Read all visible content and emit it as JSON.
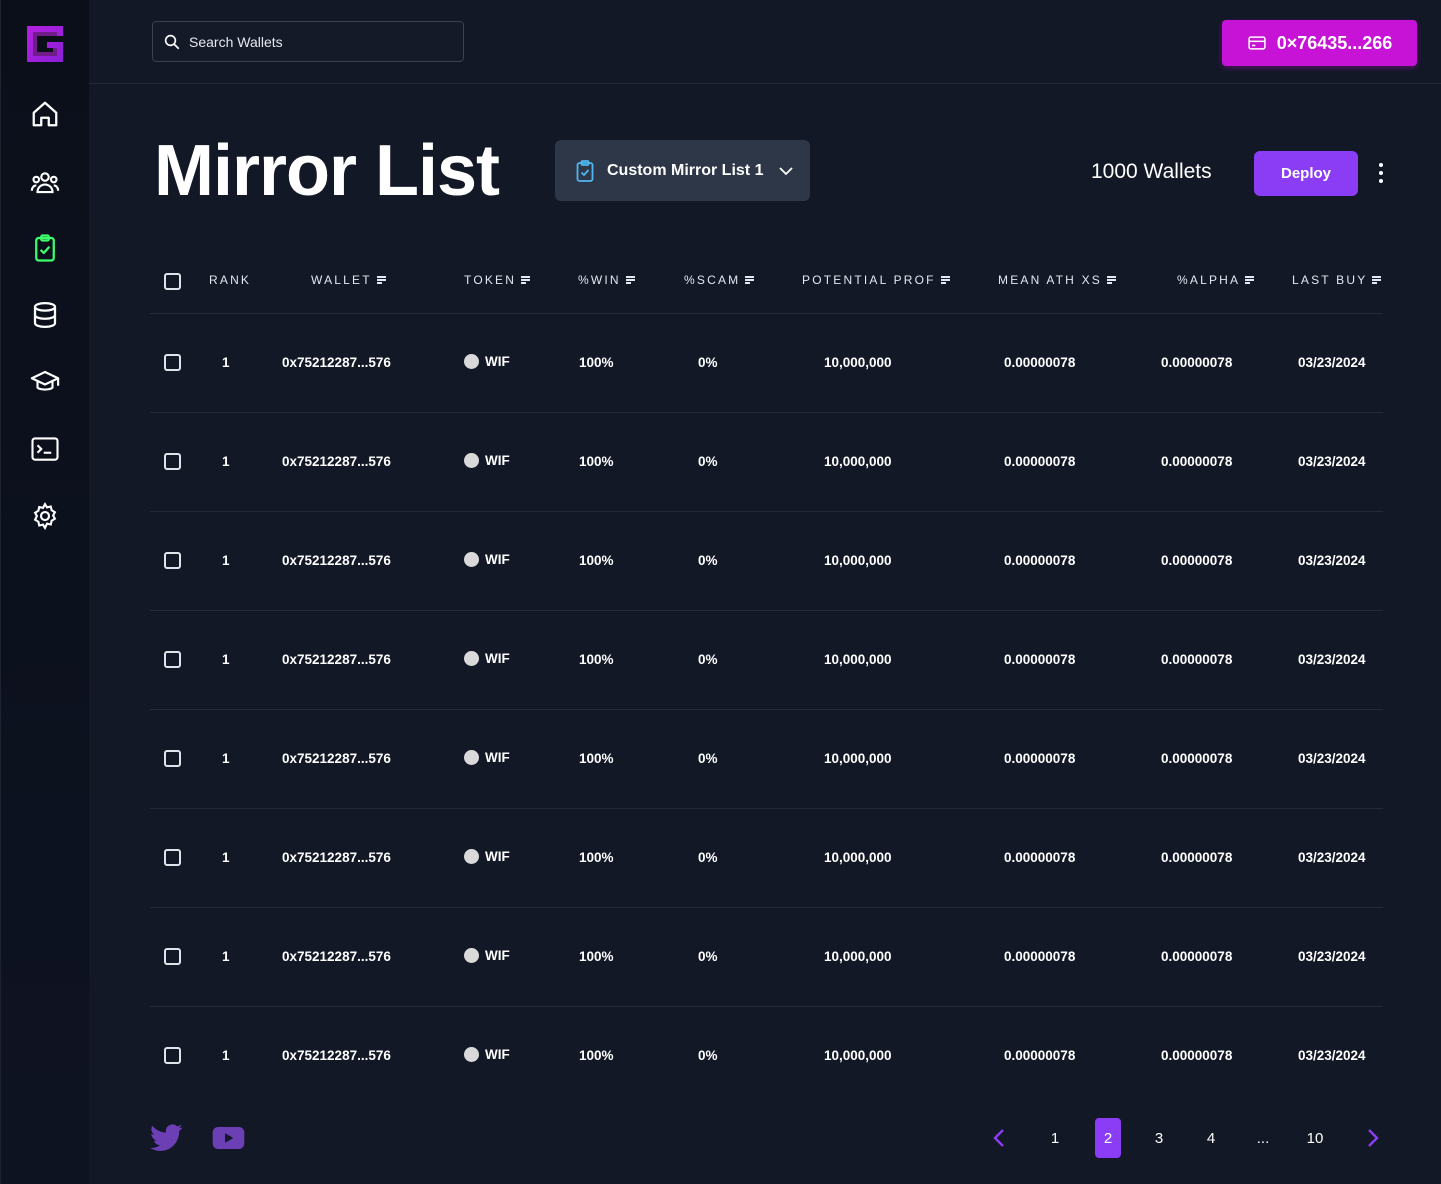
{
  "colors": {
    "accent": "#8b3df5",
    "wallet_button": "#c613d6",
    "active_nav": "#3dff6a",
    "background": "#121826"
  },
  "sidebar": {
    "items": [
      {
        "icon": "home-icon"
      },
      {
        "icon": "users-icon"
      },
      {
        "icon": "clipboard-check-icon",
        "active": true
      },
      {
        "icon": "database-icon"
      },
      {
        "icon": "graduation-cap-icon"
      },
      {
        "icon": "terminal-icon"
      },
      {
        "icon": "gear-icon"
      }
    ]
  },
  "topbar": {
    "search_placeholder": "Search Wallets",
    "wallet_address": "0×76435...266"
  },
  "header": {
    "title": "Mirror List",
    "list_selector": "Custom Mirror List 1",
    "wallet_count": "1000 Wallets",
    "deploy_label": "Deploy"
  },
  "table": {
    "columns": [
      "RANK",
      "WALLET",
      "TOKEN",
      "%WIN",
      "%SCAM",
      "POTENTIAL PROF",
      "MEAN ATH XS",
      "%ALPHA",
      "LAST BUY"
    ],
    "rows": [
      {
        "rank": "1",
        "wallet": "0x75212287...576",
        "token": "WIF",
        "win": "100%",
        "scam": "0%",
        "potential": "10,000,000",
        "mean_ath": "0.00000078",
        "alpha": "0.00000078",
        "last_buy": "03/23/2024"
      },
      {
        "rank": "1",
        "wallet": "0x75212287...576",
        "token": "WIF",
        "win": "100%",
        "scam": "0%",
        "potential": "10,000,000",
        "mean_ath": "0.00000078",
        "alpha": "0.00000078",
        "last_buy": "03/23/2024"
      },
      {
        "rank": "1",
        "wallet": "0x75212287...576",
        "token": "WIF",
        "win": "100%",
        "scam": "0%",
        "potential": "10,000,000",
        "mean_ath": "0.00000078",
        "alpha": "0.00000078",
        "last_buy": "03/23/2024"
      },
      {
        "rank": "1",
        "wallet": "0x75212287...576",
        "token": "WIF",
        "win": "100%",
        "scam": "0%",
        "potential": "10,000,000",
        "mean_ath": "0.00000078",
        "alpha": "0.00000078",
        "last_buy": "03/23/2024"
      },
      {
        "rank": "1",
        "wallet": "0x75212287...576",
        "token": "WIF",
        "win": "100%",
        "scam": "0%",
        "potential": "10,000,000",
        "mean_ath": "0.00000078",
        "alpha": "0.00000078",
        "last_buy": "03/23/2024"
      },
      {
        "rank": "1",
        "wallet": "0x75212287...576",
        "token": "WIF",
        "win": "100%",
        "scam": "0%",
        "potential": "10,000,000",
        "mean_ath": "0.00000078",
        "alpha": "0.00000078",
        "last_buy": "03/23/2024"
      },
      {
        "rank": "1",
        "wallet": "0x75212287...576",
        "token": "WIF",
        "win": "100%",
        "scam": "0%",
        "potential": "10,000,000",
        "mean_ath": "0.00000078",
        "alpha": "0.00000078",
        "last_buy": "03/23/2024"
      },
      {
        "rank": "1",
        "wallet": "0x75212287...576",
        "token": "WIF",
        "win": "100%",
        "scam": "0%",
        "potential": "10,000,000",
        "mean_ath": "0.00000078",
        "alpha": "0.00000078",
        "last_buy": "03/23/2024"
      }
    ]
  },
  "footer": {
    "social": [
      "twitter-icon",
      "youtube-icon"
    ],
    "pagination": {
      "pages": [
        "1",
        "2",
        "3",
        "4",
        "...",
        "10"
      ],
      "current": "2"
    }
  }
}
